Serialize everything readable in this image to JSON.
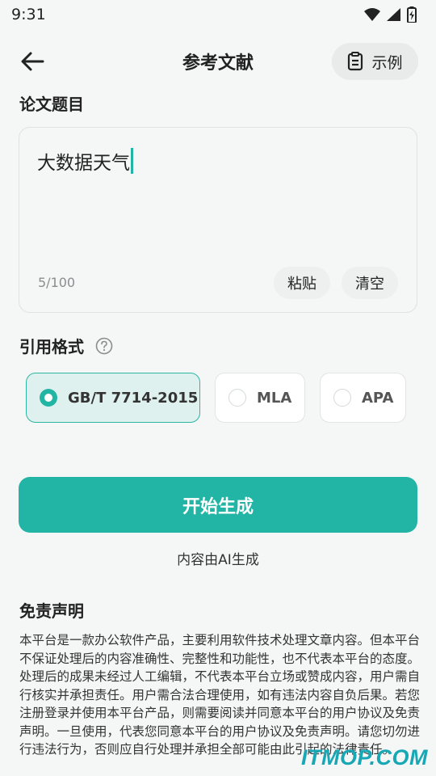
{
  "status_bar": {
    "time": "9:31",
    "icons": [
      "wifi-icon",
      "signal-icon",
      "battery-icon"
    ]
  },
  "header": {
    "title": "参考文献",
    "back_icon": "arrow-left-icon",
    "example_button": {
      "icon": "clipboard-icon",
      "label": "示例"
    }
  },
  "paper_title": {
    "label": "论文题目",
    "value": "大数据天气",
    "count": "5/100",
    "paste_label": "粘贴",
    "clear_label": "清空"
  },
  "citation": {
    "label": "引用格式",
    "help_icon": "question-circle-icon",
    "options": [
      {
        "label": "GB/T 7714-2015",
        "selected": true
      },
      {
        "label": "MLA",
        "selected": false
      },
      {
        "label": "APA",
        "selected": false
      }
    ]
  },
  "generate": {
    "label": "开始生成",
    "note": "内容由AI生成"
  },
  "disclaimer": {
    "title": "免责声明",
    "text": "本平台是一款办公软件产品，主要利用软件技术处理文章内容。但本平台不保证处理后的内容准确性、完整性和功能性，也不代表本平台的态度。处理后的成果未经过人工编辑，不代表本平台立场或赞成内容，用户需自行核实并承担责任。用户需合法合理使用，如有违法内容自负后果。若您注册登录并使用本平台产品，则需要阅读并同意本平台的用户协议及免责声明。一旦使用，代表您同意本平台的用户协议及免责声明。请您切勿进行违法行为，否则应自行处理并承担全部可能由此引起的法律责任。"
  },
  "watermark": "ITMOP.COM",
  "colors": {
    "accent": "#22b5a6",
    "selected_bg": "#dff1ee",
    "background": "#f5f6f6"
  }
}
